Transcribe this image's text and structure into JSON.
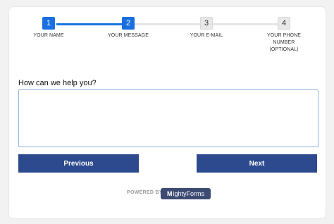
{
  "steps": [
    {
      "number": "1",
      "label": "YOUR NAME"
    },
    {
      "number": "2",
      "label": "YOUR MESSAGE"
    },
    {
      "number": "3",
      "label": "YOUR E-MAIL"
    },
    {
      "number": "4",
      "label": "YOUR PHONE NUMBER (OPTIONAL)"
    }
  ],
  "form": {
    "question": "How can we help you?",
    "message_value": ""
  },
  "buttons": {
    "previous": "Previous",
    "next": "Next"
  },
  "footer": {
    "powered_by": "POWERED BY",
    "brand_mark": "M",
    "brand_rest": "ightyForms"
  },
  "colors": {
    "active_step": "#1a6fe0",
    "button": "#2d4a8f",
    "brand_badge": "#3d4b73"
  }
}
